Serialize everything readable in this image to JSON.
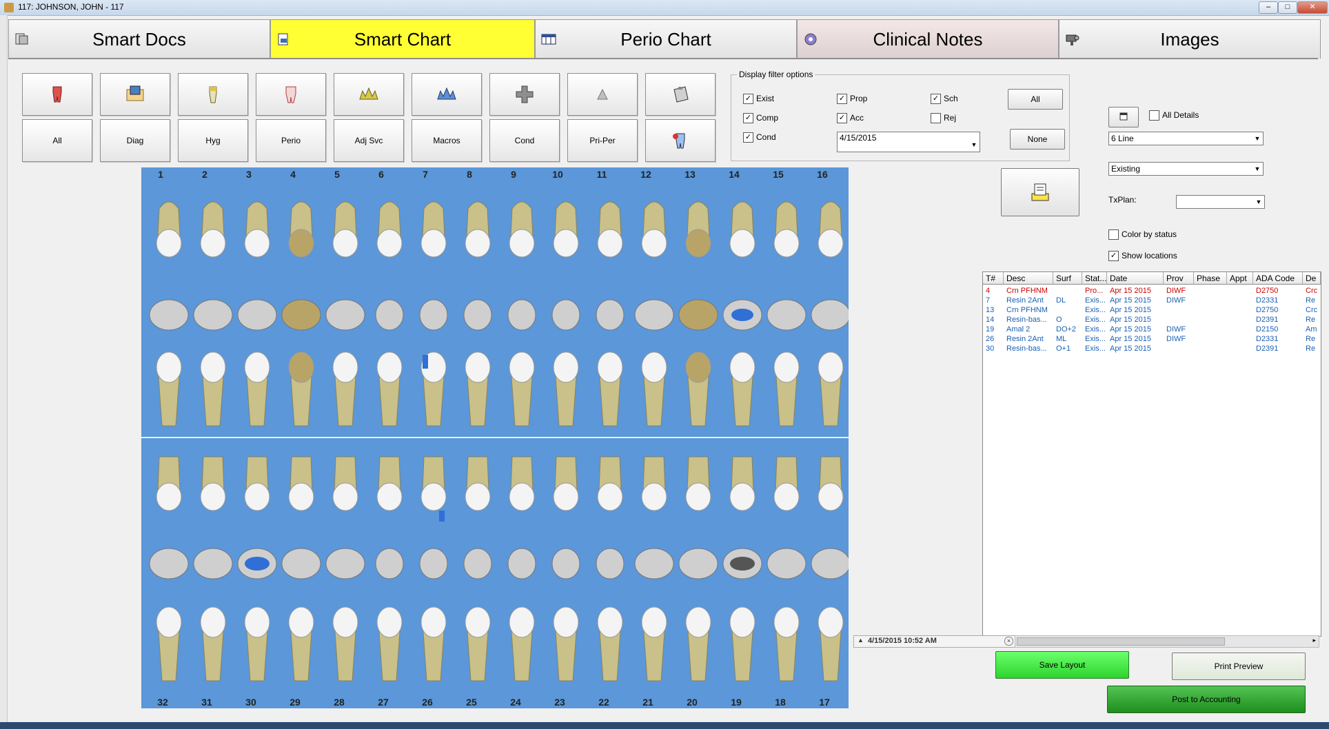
{
  "window": {
    "title": "117: JOHNSON, JOHN - 117"
  },
  "tabs": [
    {
      "label": "Smart Docs",
      "icon": "documents-icon"
    },
    {
      "label": "Smart Chart",
      "icon": "chart-icon"
    },
    {
      "label": "Perio Chart",
      "icon": "perio-grid-icon"
    },
    {
      "label": "Clinical Notes",
      "icon": "notes-icon"
    },
    {
      "label": "Images",
      "icon": "camera-icon"
    }
  ],
  "toolbar": {
    "icon_buttons": [
      "tooth-crown-icon",
      "diagnosis-icon",
      "hygiene-icon",
      "perio-tooth-icon",
      "adjunct-service-icon",
      "macros-icon",
      "condition-cross-icon",
      "pre-perio-icon",
      "clipboard-icon"
    ],
    "text_buttons": [
      "All",
      "Diag",
      "Hyg",
      "Perio",
      "Adj Svc",
      "Macros",
      "Cond",
      "Pri-Per"
    ],
    "last_icon": "tooth-paint-icon"
  },
  "filters": {
    "legend": "Display filter options",
    "exist": {
      "label": "Exist",
      "checked": true
    },
    "comp": {
      "label": "Comp",
      "checked": true
    },
    "cond": {
      "label": "Cond",
      "checked": true
    },
    "prop": {
      "label": "Prop",
      "checked": true
    },
    "acc": {
      "label": "Acc",
      "checked": true
    },
    "sch": {
      "label": "Sch",
      "checked": true
    },
    "rej": {
      "label": "Rej",
      "checked": false
    },
    "date": "4/15/2015",
    "all_button": "All",
    "none_button": "None"
  },
  "right_panel": {
    "all_details": {
      "label": "All Details",
      "checked": false
    },
    "line_select": "6 Line",
    "status_select": "Existing",
    "txplan_label": "TxPlan:",
    "txplan_value": "",
    "color_by_status": {
      "label": "Color by status",
      "checked": false
    },
    "show_locations": {
      "label": "Show locations",
      "checked": true
    }
  },
  "tooth_numbers": {
    "upper": [
      "1",
      "2",
      "3",
      "4",
      "5",
      "6",
      "7",
      "8",
      "9",
      "10",
      "11",
      "12",
      "13",
      "14",
      "15",
      "16"
    ],
    "lower": [
      "32",
      "31",
      "30",
      "29",
      "28",
      "27",
      "26",
      "25",
      "24",
      "23",
      "22",
      "21",
      "20",
      "19",
      "18",
      "17"
    ]
  },
  "grid": {
    "headers": [
      "T#",
      "Desc",
      "Surf",
      "Stat...",
      "Date",
      "Prov",
      "Phase",
      "Appt",
      "ADA Code",
      "De"
    ],
    "rows": [
      {
        "t": "4",
        "desc": "Crn PFHNM",
        "surf": "",
        "stat": "Pro...",
        "date": "Apr 15 2015",
        "prov": "DIWF",
        "phase": "",
        "appt": "",
        "ada": "D2750",
        "de": "Crc",
        "color": "#cc0000"
      },
      {
        "t": "7",
        "desc": "Resin 2Ant",
        "surf": "DL",
        "stat": "Exis...",
        "date": "Apr 15 2015",
        "prov": "DIWF",
        "phase": "",
        "appt": "",
        "ada": "D2331",
        "de": "Re",
        "color": "#1a5fb4"
      },
      {
        "t": "13",
        "desc": "Crn PFHNM",
        "surf": "",
        "stat": "Exis...",
        "date": "Apr 15 2015",
        "prov": "",
        "phase": "",
        "appt": "",
        "ada": "D2750",
        "de": "Crc",
        "color": "#1a5fb4"
      },
      {
        "t": "14",
        "desc": "Resin-bas...",
        "surf": "O",
        "stat": "Exis...",
        "date": "Apr 15 2015",
        "prov": "",
        "phase": "",
        "appt": "",
        "ada": "D2391",
        "de": "Re",
        "color": "#1a5fb4"
      },
      {
        "t": "19",
        "desc": "Amal 2",
        "surf": "DO+2",
        "stat": "Exis...",
        "date": "Apr 15 2015",
        "prov": "DIWF",
        "phase": "",
        "appt": "",
        "ada": "D2150",
        "de": "Am",
        "color": "#1a5fb4"
      },
      {
        "t": "26",
        "desc": "Resin 2Ant",
        "surf": "ML",
        "stat": "Exis...",
        "date": "Apr 15 2015",
        "prov": "DIWF",
        "phase": "",
        "appt": "",
        "ada": "D2331",
        "de": "Re",
        "color": "#1a5fb4"
      },
      {
        "t": "30",
        "desc": "Resin-bas...",
        "surf": "O+1",
        "stat": "Exis...",
        "date": "Apr 15 2015",
        "prov": "",
        "phase": "",
        "appt": "",
        "ada": "D2391",
        "de": "Re",
        "color": "#1a5fb4"
      }
    ]
  },
  "timestamp": "4/15/2015 10:52 AM",
  "buttons": {
    "save_layout": "Save Layout",
    "print_preview": "Print Preview",
    "post_to_accounting": "Post to Accounting"
  }
}
